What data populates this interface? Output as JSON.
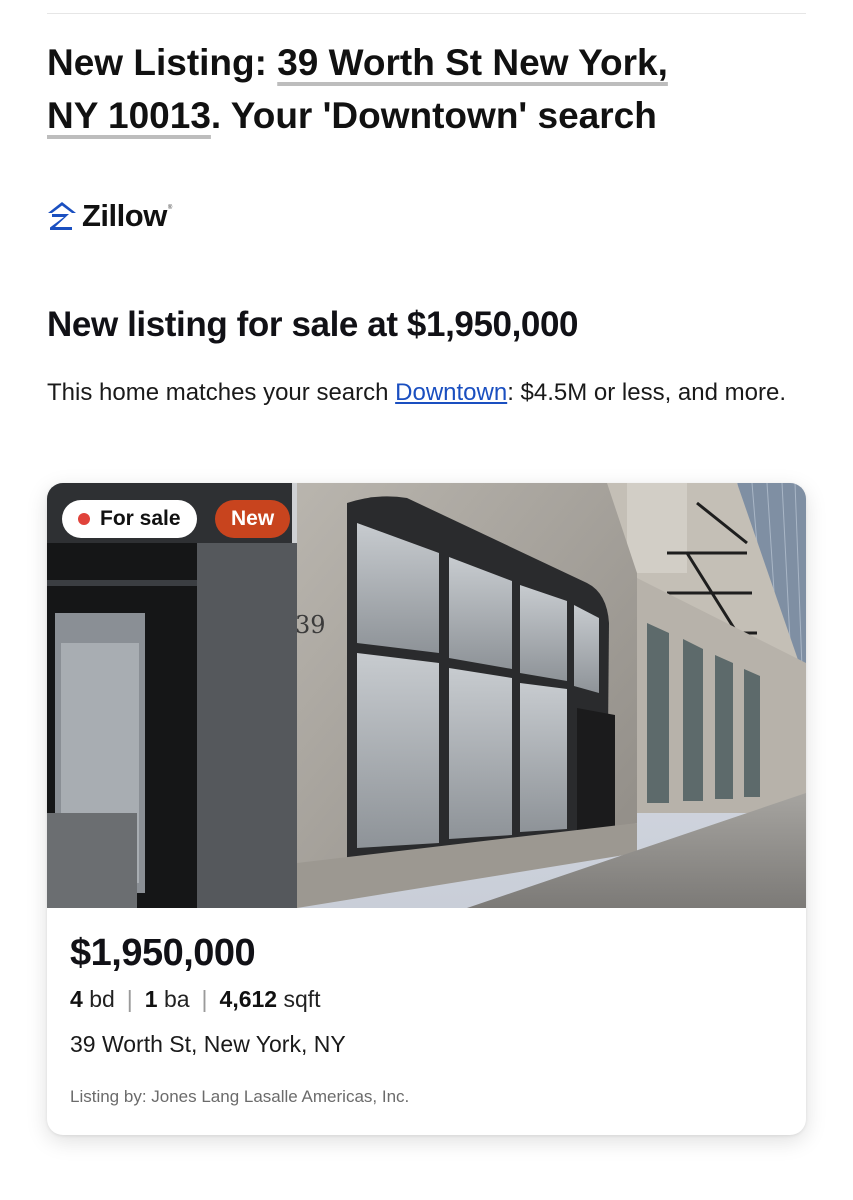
{
  "email": {
    "subject_prefix": "New Listing: ",
    "subject_address_part1": "39 Worth St New York,",
    "subject_address_part2": "NY 10013",
    "subject_suffix": ". Your 'Downtown' search"
  },
  "brand": {
    "name": "Zillow",
    "registered_mark": "®",
    "logo_icon": "zillow-logo-icon",
    "color": "#1a4fc0"
  },
  "headline": "New listing for sale at $1,950,000",
  "description": {
    "prefix": "This home matches your search ",
    "search_link": "Downtown",
    "suffix": ": $4.5M or less, and more."
  },
  "listing": {
    "badge_for_sale": "For sale",
    "badge_for_sale_dot_color": "#e0433b",
    "badge_new": "New",
    "badge_new_color": "#c8441e",
    "price": "$1,950,000",
    "beds_value": "4",
    "beds_unit": "bd",
    "baths_value": "1",
    "baths_unit": "ba",
    "sqft_value": "4,612",
    "sqft_unit": "sqft",
    "separator": "|",
    "address": "39 Worth St, New York, NY",
    "listed_by": "Listing by: Jones Lang Lasalle Americas, Inc.",
    "building_number": "39",
    "photo_alt": "Storefront of 39 Worth St"
  }
}
